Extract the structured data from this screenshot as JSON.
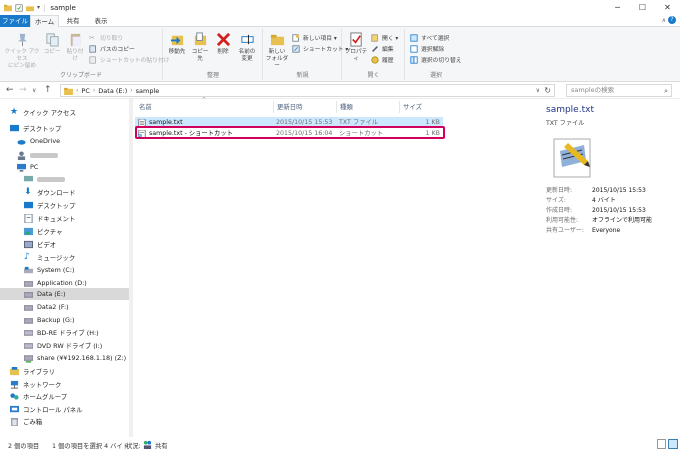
{
  "window": {
    "title": "sample",
    "minimize": "─",
    "maximize": "☐",
    "close": "✕"
  },
  "ribbon_tabs": {
    "file": "ファイル",
    "home": "ホーム",
    "share": "共有",
    "view": "表示"
  },
  "ribbon": {
    "clipboard": {
      "label": "クリップボード",
      "pin": "クイック アクセス\nにピン留め",
      "copy": "コピー",
      "paste": "貼り付け",
      "cut": "切り取り",
      "copy_path": "パスのコピー",
      "paste_shortcut": "ショートカットの貼り付け"
    },
    "organize": {
      "label": "整理",
      "move_to": "移動先",
      "copy_to": "コピー先",
      "delete": "削除",
      "rename": "名前の\n変更"
    },
    "new": {
      "label": "新規",
      "new_folder": "新しい\nフォルダー",
      "new_item": "新しい項目 ▾",
      "shortcut": "ショートカット ▾"
    },
    "open": {
      "label": "開く",
      "properties": "プロパティ",
      "open": "開く ▾",
      "edit": "編集",
      "history": "履歴"
    },
    "select": {
      "label": "選択",
      "select_all": "すべて選択",
      "select_none": "選択解除",
      "invert": "選択の切り替え"
    }
  },
  "address": {
    "root": "PC",
    "drive": "Data (E:)",
    "folder": "sample"
  },
  "search": {
    "placeholder": "sampleの検索"
  },
  "nav": {
    "quick_access": "クイック アクセス",
    "desktop_top": "デスクトップ",
    "onedrive": "OneDrive",
    "pc": "PC",
    "downloads": "ダウンロード",
    "desktop": "デスクトップ",
    "documents": "ドキュメント",
    "pictures": "ピクチャ",
    "videos": "ビデオ",
    "music": "ミュージック",
    "system_c": "System (C:)",
    "application_d": "Application (D:)",
    "data_e": "Data (E:)",
    "data2_f": "Data2 (F:)",
    "backup_g": "Backup (G:)",
    "bdre_h": "BD-RE ドライブ (H:)",
    "dvdrw_i": "DVD RW ドライブ (I:)",
    "share_z": "share (¥¥192.168.1.18) (Z:)",
    "libraries": "ライブラリ",
    "network": "ネットワーク",
    "homegroup": "ホームグループ",
    "control_panel": "コントロール パネル",
    "recycle_bin": "ごみ箱"
  },
  "columns": {
    "name": "名前",
    "date": "更新日時",
    "type": "種類",
    "size": "サイズ"
  },
  "files": [
    {
      "name": "sample.txt",
      "date": "2015/10/15 15:53",
      "type": "TXT ファイル",
      "size": "1 KB"
    },
    {
      "name": "sample.txt - ショートカット",
      "date": "2015/10/15 16:04",
      "type": "ショートカット",
      "size": "1 KB"
    }
  ],
  "preview": {
    "title": "sample.txt",
    "type": "TXT ファイル",
    "props": [
      {
        "k": "更新日時:",
        "v": "2015/10/15 15:53"
      },
      {
        "k": "サイズ:",
        "v": "4 バイト"
      },
      {
        "k": "作成日時:",
        "v": "2015/10/15 15:53"
      },
      {
        "k": "利用可能性:",
        "v": "オフラインで利用可能"
      },
      {
        "k": "共有ユーザー:",
        "v": "Everyone"
      }
    ]
  },
  "status": {
    "count": "2 個の項目",
    "selected": "1 個の項目を選択 4 バイト",
    "state_label": "状況:",
    "state": "共有"
  },
  "colors": {
    "accent": "#1979ca",
    "selection": "#cce8ff",
    "highlight": "#d1005e"
  }
}
